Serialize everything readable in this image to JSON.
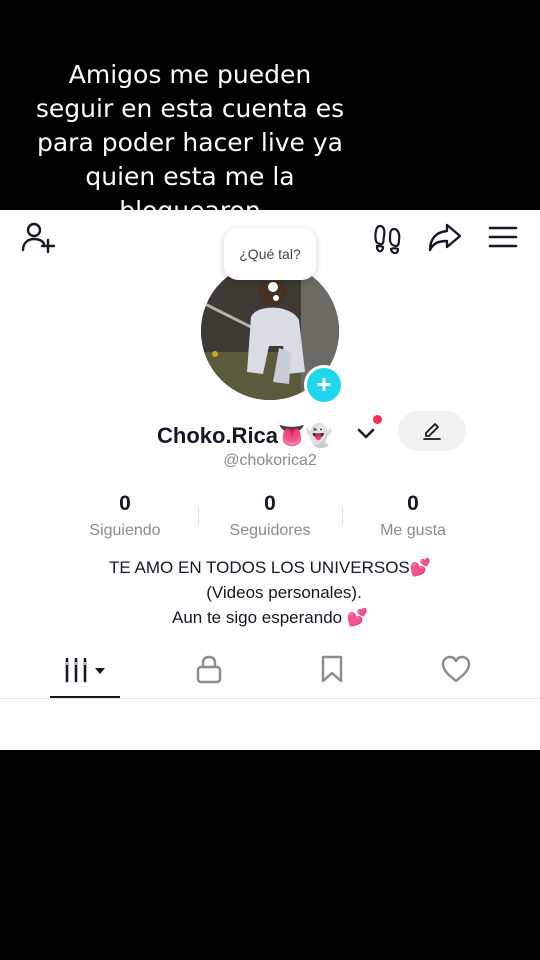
{
  "caption": {
    "lines": [
      "Amigos me pueden",
      "seguir en esta cuenta es",
      "para poder hacer live ya",
      "quien esta me la",
      "bloquearon"
    ]
  },
  "topbar": {
    "icons": [
      "add-friend-icon",
      "footprints-icon",
      "share-icon",
      "menu-icon"
    ]
  },
  "profile": {
    "thought_bubble": "¿Qué tal?",
    "display_name": "Choko.Rica👅👻",
    "handle": "@chokorica2",
    "stats": [
      {
        "value": "0",
        "label": "Siguiendo"
      },
      {
        "value": "0",
        "label": "Seguidores"
      },
      {
        "value": "0",
        "label": "Me gusta"
      }
    ],
    "bio": [
      "TE AMO EN TODOS LOS UNIVERSOS💕",
      "(Videos personales).",
      "Aun te sigo esperando 💕"
    ]
  },
  "tabs": {
    "icons": [
      "videos-grid-icon",
      "lock-icon",
      "bookmark-icon",
      "heart-icon"
    ],
    "active": 0
  },
  "colors": {
    "accent_cyan": "#20d5ec",
    "notification_red": "#fe2c55",
    "text_primary": "#161823",
    "text_secondary": "#8a8b91"
  }
}
